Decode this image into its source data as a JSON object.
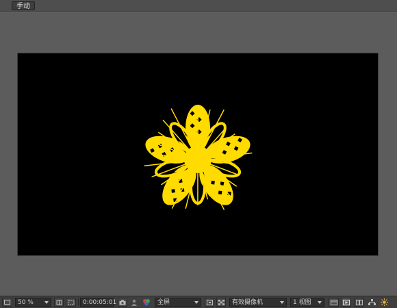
{
  "top_tab": {
    "label": "手动"
  },
  "statusbar": {
    "zoom": "50 %",
    "timecode": "0:00:05:01",
    "resolution": "全屏",
    "camera": "有效摄像机",
    "views": "1 视图"
  },
  "colors": {
    "panel_bg": "#5b5b5b",
    "canvas_bg": "#000000",
    "flower": "#ffdb00",
    "statusbar_bg": "#3f3f3f"
  },
  "icons": [
    "always-preview-icon",
    "resolution-icon",
    "region-of-interest-icon",
    "snapshot-icon",
    "show-snapshot-icon",
    "color-channels-icon",
    "transparency-grid-icon",
    "fast-preview-icon",
    "toggle-view-icon",
    "flowchart-icon",
    "exposure-icon"
  ]
}
